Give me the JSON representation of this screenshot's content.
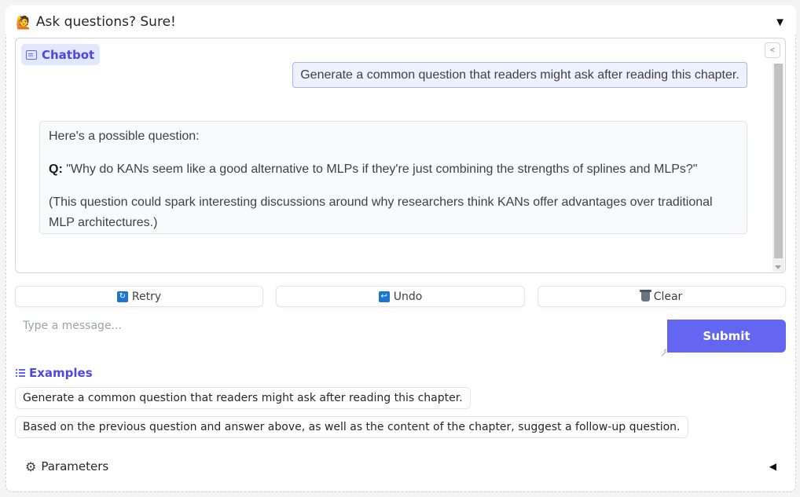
{
  "accordion": {
    "emoji": "🙋",
    "title": "Ask questions? Sure!",
    "toggle": "▼"
  },
  "chatbot": {
    "label": "Chatbot",
    "share_icon": "share-icon",
    "messages": {
      "user": "Generate a common question that readers might ask after reading this chapter.",
      "bot_intro": "Here's a possible question:",
      "bot_q_label": "Q:",
      "bot_q_text": " \"Why do KANs seem like a good alternative to MLPs if they're just combining the strengths of splines and MLPs?\"",
      "bot_note": "(This question could spark interesting discussions around why researchers think KANs offer advantages over traditional MLP architectures.)"
    }
  },
  "actions": {
    "retry": {
      "icon": "retry-icon",
      "label": "Retry"
    },
    "undo": {
      "icon": "undo-icon",
      "label": "Undo"
    },
    "clear": {
      "icon": "trash-icon",
      "label": "Clear"
    }
  },
  "input": {
    "placeholder": "Type a message...",
    "value": ""
  },
  "submit_label": "Submit",
  "examples": {
    "label": "Examples",
    "items": [
      "Generate a common question that readers might ask after reading this chapter.",
      "Based on the previous question and answer above, as well as the content of the chapter, suggest a follow-up question."
    ]
  },
  "parameters": {
    "label": "Parameters",
    "toggle": "◀"
  },
  "colors": {
    "accent": "#6366f1",
    "accent_text": "#4f46e5",
    "user_bubble": "#eef2ff",
    "label_bg": "#e0e7ff"
  }
}
